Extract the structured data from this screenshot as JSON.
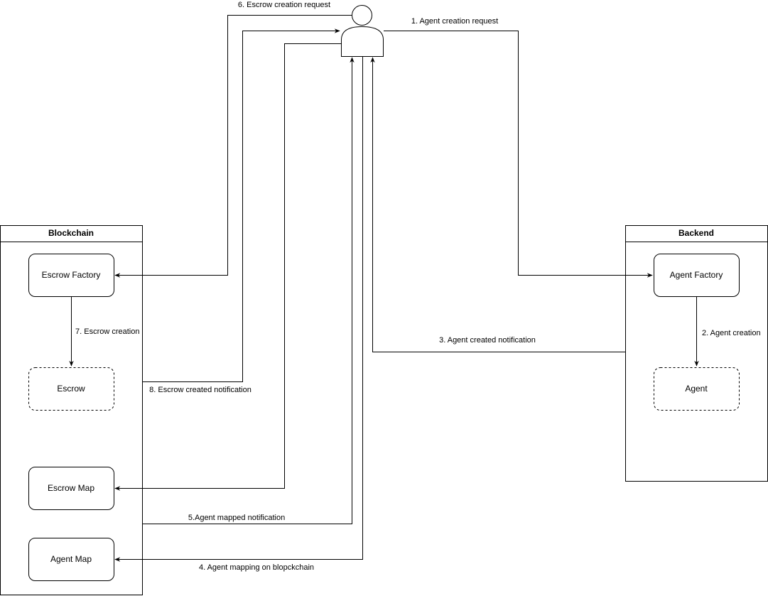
{
  "containers": {
    "blockchain": {
      "title": "Blockchain"
    },
    "backend": {
      "title": "Backend"
    }
  },
  "nodes": {
    "escrow_factory": "Escrow Factory",
    "escrow": "Escrow",
    "escrow_map": "Escrow Map",
    "agent_map": "Agent Map",
    "agent_factory": "Agent Factory",
    "agent": "Agent"
  },
  "actor": {
    "icon": "user-icon"
  },
  "edges": {
    "e1": "1. Agent creation request",
    "e2": "2. Agent creation",
    "e3": "3. Agent created notification",
    "e4": "4. Agent mapping on blopckchain",
    "e5": "5.Agent mapped notification",
    "e6": "6. Escrow creation request",
    "e7": "7. Escrow creation",
    "e8": "8. Escrow created notification"
  }
}
